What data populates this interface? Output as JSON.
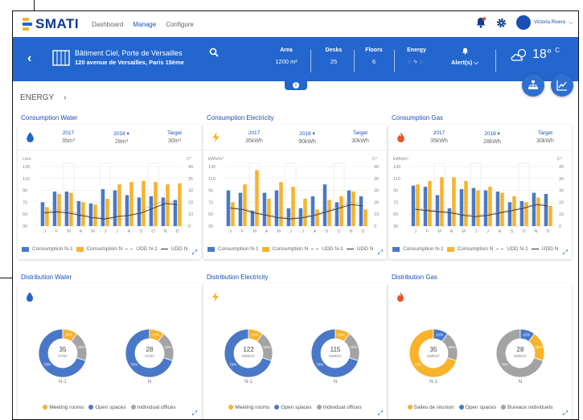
{
  "app": {
    "logo_text": "SMATI",
    "nav": [
      "Dashboard",
      "Manage",
      "Configure"
    ],
    "active_nav": "Manage",
    "user_name": "Victoria Rivera"
  },
  "site": {
    "name": "Bâtiment Ciel, Porte de Versailles",
    "address": "120 avenue de Versailles, Paris 15ème"
  },
  "kpis": [
    {
      "label": "Area",
      "value": "1200 m²"
    },
    {
      "label": "Desks",
      "value": "25"
    },
    {
      "label": "Floors",
      "value": "6"
    },
    {
      "label": "Energy",
      "value": ""
    },
    {
      "label": "Alert(s)",
      "value": ""
    }
  ],
  "weather": {
    "temp": "18°",
    "unit": "C"
  },
  "breadcrumb": "ENERGY",
  "colors": {
    "blue": "#4a78c8",
    "orange": "#f7b32b",
    "gray": "#a3a3a3",
    "primary": "#2366cd"
  },
  "consumption_cards": [
    {
      "title": "Consumption Water",
      "icon": "water-drop-icon",
      "icon_color": "#2366cd",
      "cols": [
        {
          "label": "2017",
          "value": "35m³"
        },
        {
          "label": "2018 ▾",
          "value": "28m³"
        },
        {
          "label": "Target",
          "value": "30m³"
        }
      ],
      "yunit": "Litre",
      "y2unit": "C°",
      "yticks": [
        "130",
        "110",
        "90",
        "70",
        "50",
        "30"
      ],
      "y2ticks": [
        "40",
        "35",
        "30",
        "20",
        "10",
        "0"
      ]
    },
    {
      "title": "Consumption Electricity",
      "icon": "lightning-icon",
      "icon_color": "#f7b32b",
      "cols": [
        {
          "label": "2017",
          "value": "35kWh"
        },
        {
          "label": "2018 ▾",
          "value": "90kWh"
        },
        {
          "label": "Target",
          "value": "30kWh"
        }
      ],
      "yunit": "kWh/m²",
      "y2unit": "C°",
      "yticks": [
        "130",
        "110",
        "90",
        "70",
        "50",
        "30"
      ],
      "y2ticks": [
        "40",
        "35",
        "30",
        "20",
        "10",
        "0"
      ]
    },
    {
      "title": "Consumption Gas",
      "icon": "flame-icon",
      "icon_color": "#e2522b",
      "cols": [
        {
          "label": "2017",
          "value": "35kWh"
        },
        {
          "label": "2018 ▾",
          "value": "28kWh"
        },
        {
          "label": "Target",
          "value": "30kWh"
        }
      ],
      "yunit": "kWh/m²",
      "y2unit": "C°",
      "yticks": [
        "130",
        "110",
        "90",
        "70",
        "50",
        "30"
      ],
      "y2ticks": [
        "40",
        "35",
        "30",
        "20",
        "10",
        "0"
      ]
    }
  ],
  "months": [
    "J",
    "F",
    "M",
    "A",
    "M",
    "J",
    "J",
    "A",
    "S",
    "O",
    "N",
    "D"
  ],
  "chart_legend": [
    "Consumption N-1",
    "Consumption N",
    "UDD N-1",
    "UDD N"
  ],
  "distribution_cards": [
    {
      "title": "Distribution Water",
      "icon": "water-drop-icon",
      "icon_color": "#2366cd",
      "donuts": [
        {
          "value": "35",
          "unit": "m³/m²",
          "label": "N-1",
          "pcts": [
            "70%",
            "10%",
            "20%"
          ]
        },
        {
          "value": "28",
          "unit": "m³/m²",
          "label": "N",
          "pcts": [
            "70%",
            "10%",
            "20%"
          ]
        }
      ],
      "legend": [
        "Meeting rooms",
        "Open spaces",
        "Individual offices"
      ]
    },
    {
      "title": "Distribution Electricity",
      "icon": "lightning-icon",
      "icon_color": "#f7b32b",
      "donuts": [
        {
          "value": "122",
          "unit": "kWh/m²",
          "label": "N-1",
          "pcts": [
            "70%",
            "10%",
            "20%"
          ]
        },
        {
          "value": "115",
          "unit": "kWh/m²",
          "label": "N",
          "pcts": [
            "70%",
            "10%",
            "20%"
          ]
        }
      ],
      "legend": [
        "Meeting rooms",
        "Open spaces",
        "Individual offices"
      ]
    },
    {
      "title": "Distribution Gas",
      "icon": "flame-icon",
      "icon_color": "#e2522b",
      "donuts": [
        {
          "value": "35",
          "unit": "kWh/m²",
          "label": "N-1",
          "pcts": [
            "70%",
            "10%",
            "20%"
          ]
        },
        {
          "value": "28",
          "unit": "kWh/m²",
          "label": "N",
          "pcts": [
            "70%",
            "10%",
            "20%"
          ]
        }
      ],
      "legend": [
        "Salles de réunion",
        "Open spaces",
        "Bureaux individuels"
      ]
    }
  ],
  "chart_data": [
    {
      "type": "bar",
      "title": "Consumption Water",
      "categories": [
        "J",
        "F",
        "M",
        "A",
        "M",
        "J",
        "J",
        "A",
        "S",
        "O",
        "N",
        "D"
      ],
      "ylim": [
        30,
        130
      ],
      "series": [
        {
          "name": "Consumption N-1",
          "values": [
            70,
            88,
            88,
            72,
            68,
            92,
            90,
            82,
            78,
            80,
            78,
            74
          ]
        },
        {
          "name": "Consumption N",
          "values": [
            62,
            84,
            86,
            70,
            66,
            76,
            100,
            104,
            106,
            104,
            100,
            102
          ]
        },
        {
          "name": "UDD N-1",
          "values": [
            54,
            58,
            56,
            50,
            46,
            44,
            40,
            44,
            56,
            66,
            72,
            70
          ]
        },
        {
          "name": "UDD N",
          "values": [
            52,
            54,
            52,
            48,
            44,
            42,
            46,
            48,
            52,
            60,
            68,
            66
          ]
        }
      ]
    },
    {
      "type": "bar",
      "title": "Consumption Electricity",
      "categories": [
        "J",
        "F",
        "M",
        "A",
        "M",
        "J",
        "J",
        "A",
        "S",
        "O",
        "N",
        "D"
      ],
      "ylim": [
        30,
        130
      ],
      "series": [
        {
          "name": "Consumption N-1",
          "values": [
            90,
            86,
            56,
            86,
            90,
            60,
            60,
            80,
            100,
            70,
            90,
            80
          ]
        },
        {
          "name": "Consumption N",
          "values": [
            70,
            100,
            124,
            76,
            104,
            96,
            76,
            58,
            74,
            80,
            88,
            58
          ]
        },
        {
          "name": "UDD N-1",
          "values": [
            62,
            60,
            54,
            50,
            46,
            44,
            46,
            50,
            56,
            62,
            70,
            66
          ]
        },
        {
          "name": "UDD N",
          "values": [
            60,
            58,
            52,
            48,
            44,
            42,
            44,
            48,
            54,
            60,
            66,
            64
          ]
        }
      ]
    },
    {
      "type": "bar",
      "title": "Consumption Gas",
      "categories": [
        "J",
        "F",
        "M",
        "A",
        "M",
        "J",
        "J",
        "A",
        "S",
        "O",
        "N",
        "D"
      ],
      "ylim": [
        30,
        130
      ],
      "series": [
        {
          "name": "Consumption N-1",
          "values": [
            98,
            96,
            82,
            60,
            92,
            94,
            90,
            88,
            70,
            72,
            86,
            84
          ]
        },
        {
          "name": "Consumption N",
          "values": [
            100,
            106,
            112,
            112,
            106,
            90,
            96,
            86,
            80,
            70,
            78,
            64
          ]
        },
        {
          "name": "UDD N-1",
          "values": [
            60,
            58,
            56,
            54,
            50,
            48,
            50,
            54,
            58,
            62,
            68,
            66
          ]
        },
        {
          "name": "UDD N",
          "values": [
            58,
            56,
            54,
            52,
            48,
            46,
            48,
            52,
            56,
            60,
            66,
            64
          ]
        }
      ]
    }
  ]
}
